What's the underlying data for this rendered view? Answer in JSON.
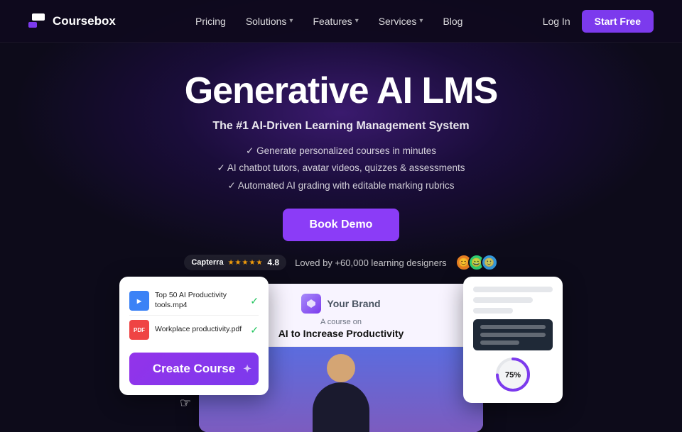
{
  "nav": {
    "logo_text": "Coursebox",
    "links": [
      {
        "label": "Pricing",
        "has_dropdown": false
      },
      {
        "label": "Solutions",
        "has_dropdown": true
      },
      {
        "label": "Features",
        "has_dropdown": true
      },
      {
        "label": "Services",
        "has_dropdown": true
      },
      {
        "label": "Blog",
        "has_dropdown": false
      }
    ],
    "login_label": "Log In",
    "start_label": "Start Free"
  },
  "hero": {
    "title": "Generative AI LMS",
    "subtitle": "The #1 AI-Driven Learning Management System",
    "features": [
      "Generate personalized courses in minutes",
      "AI chatbot tutors, avatar videos, quizzes & assessments",
      "Automated AI grading with editable marking rubrics"
    ],
    "cta_label": "Book Demo",
    "social_proof": {
      "capterra_score": "4.8",
      "loved_text": "Loved by +60,000 learning designers"
    }
  },
  "upload_card": {
    "files": [
      {
        "name": "Top 50 AI Productivity tools.mp4",
        "type": "mp4",
        "done": true
      },
      {
        "name": "Workplace productivity.pdf",
        "type": "pdf",
        "done": true
      }
    ],
    "create_button": "Create Course"
  },
  "course_card": {
    "brand": "Your Brand",
    "subtitle": "A course on",
    "title": "AI to Increase Productivity"
  },
  "right_panel": {
    "progress_value": "75%"
  }
}
